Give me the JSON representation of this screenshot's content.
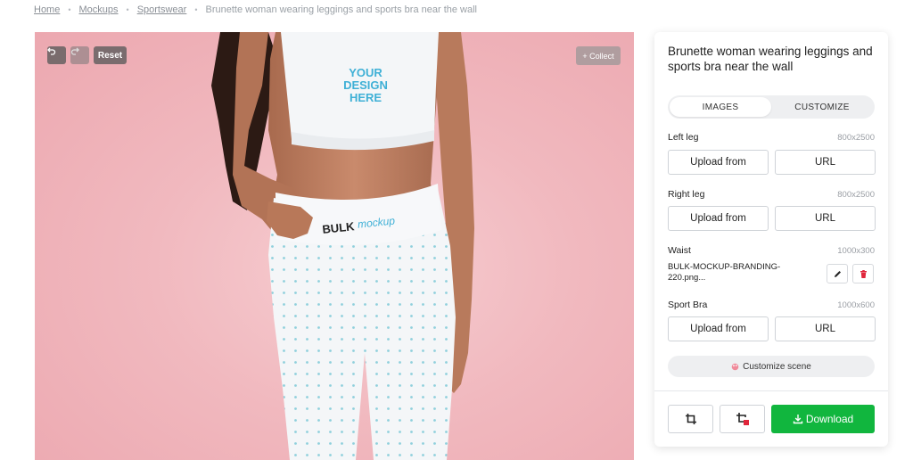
{
  "breadcrumb": {
    "items": [
      "Home",
      "Mockups",
      "Sportswear"
    ],
    "separator": "•",
    "current": "Brunette woman wearing leggings and sports bra near the wall"
  },
  "canvas": {
    "undo_icon": "undo-icon",
    "redo_icon": "redo-icon",
    "reset_label": "Reset",
    "collect_label": "+ Collect",
    "bra_text": [
      "YOUR",
      "DESIGN",
      "HERE"
    ],
    "waistband_brand": "BULK",
    "waistband_brand_script": "mockup",
    "background_color": "#f1b9bf"
  },
  "panel": {
    "title": "Brunette woman wearing leggings and sports bra near the wall",
    "tabs": [
      {
        "label": "IMAGES",
        "active": true
      },
      {
        "label": "CUSTOMIZE",
        "active": false
      }
    ],
    "fields": [
      {
        "label": "Left leg",
        "size": "800x2500",
        "upload_label": "Upload from",
        "url_label": "URL"
      },
      {
        "label": "Right leg",
        "size": "800x2500",
        "upload_label": "Upload from",
        "url_label": "URL"
      },
      {
        "label": "Waist",
        "size": "1000x300",
        "file_name": "BULK-MOCKUP-BRANDING-220.png..."
      },
      {
        "label": "Sport Bra",
        "size": "1000x600",
        "upload_label": "Upload from",
        "url_label": "URL"
      }
    ],
    "customize_label": "Customize scene",
    "download_label": "Download",
    "accent_color": "#11b63e",
    "delete_color": "#e0263c"
  }
}
